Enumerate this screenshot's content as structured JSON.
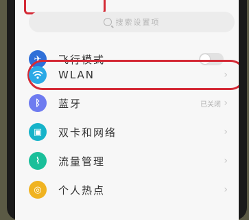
{
  "search": {
    "placeholder": "搜索设置项"
  },
  "rows": [
    {
      "label": "飞行模式",
      "icon": "airplane-icon",
      "color": "#2f6fd8"
    },
    {
      "label": "WLAN",
      "icon": "wifi-icon",
      "color": "#2aa9e6"
    },
    {
      "label": "蓝牙",
      "icon": "bluetooth-icon",
      "color": "#6e7bf0",
      "value": "已关闭"
    },
    {
      "label": "双卡和网络",
      "icon": "sim-icon",
      "color": "#16b3c9"
    },
    {
      "label": "流量管理",
      "icon": "data-usage-icon",
      "color": "#1abf9a"
    },
    {
      "label": "个人热点",
      "icon": "hotspot-icon",
      "color": "#f0b321"
    }
  ]
}
